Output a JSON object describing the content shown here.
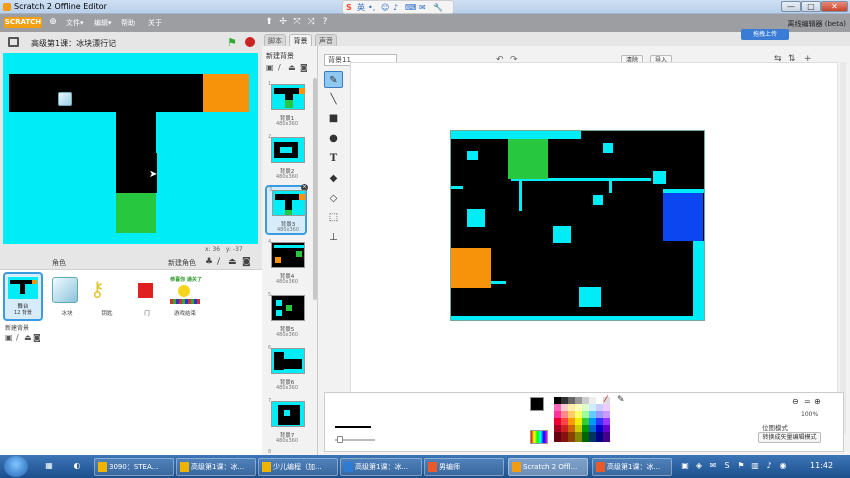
{
  "window": {
    "title": "Scratch 2 Offline Editor",
    "controls": {
      "minimize": "—",
      "maximize": "□",
      "close": "✕"
    }
  },
  "browser_overlay": {
    "items": [
      "英",
      "☺",
      "⚙",
      "✎",
      "🎤",
      "⌨",
      "✉",
      "🔧"
    ]
  },
  "menubar": {
    "logo": "SCRATCH",
    "globe_icon": "globe-icon",
    "menus": [
      "文件▾",
      "编辑▾",
      "帮助",
      "关于"
    ],
    "right_title": "离线编辑器 (beta)",
    "upload_label": "拖拽上传"
  },
  "stage": {
    "title": "高级第1课：冰块漂行记",
    "coords_x": "x: 36",
    "coords_y": "y: -37",
    "colors": {
      "bg": "#00ecf7",
      "wall": "#000000",
      "goal": "#27c83f",
      "start": "#f7930a"
    }
  },
  "sprites_panel": {
    "label": "角色",
    "new_sprite_label": "新建角色",
    "stage_thumb": {
      "name": "舞台",
      "count": "12 背景"
    },
    "new_backdrop_label": "新建背景",
    "sprites": [
      {
        "name": "冰块"
      },
      {
        "name": "钥匙"
      },
      {
        "name": "门"
      },
      {
        "name": "游戏结束",
        "text_top": "恭喜你 通关了"
      }
    ]
  },
  "tabs": [
    "脚本",
    "背景",
    "声音"
  ],
  "backdrops": {
    "header": "新建背景",
    "items": [
      {
        "num": "1",
        "name": "背景1",
        "size": "480x360"
      },
      {
        "num": "2",
        "name": "背景2",
        "size": "480x360"
      },
      {
        "num": "3",
        "name": "背景3",
        "size": "480x360"
      },
      {
        "num": "4",
        "name": "背景4",
        "size": "480x360"
      },
      {
        "num": "5",
        "name": "背景5",
        "size": "480x360"
      },
      {
        "num": "6",
        "name": "背景6",
        "size": "480x360"
      },
      {
        "num": "7",
        "name": "背景7",
        "size": "480x360"
      },
      {
        "num": "8",
        "name": "",
        "size": ""
      }
    ]
  },
  "editor": {
    "costume_name": "背景11",
    "clear_label": "清除",
    "import_label": "导入",
    "tools": [
      "brush-icon",
      "line-icon",
      "rect-icon",
      "ellipse-icon",
      "text-icon",
      "fill-icon",
      "eraser-icon",
      "select-icon",
      "stamp-icon"
    ],
    "zoom_level": "100%",
    "bitmap_mode": "位图模式",
    "convert_vector": "转换成矢量编辑模式"
  },
  "taskbar": {
    "tasks": [
      {
        "label": "3090：STEA...",
        "color": "#f0b400"
      },
      {
        "label": "高级第1课：冰...",
        "color": "#f0b400"
      },
      {
        "label": "少儿编程（加...",
        "color": "#f0b400"
      },
      {
        "label": "高级第1课：冰...",
        "color": "#2e7bd6"
      },
      {
        "label": "男编师",
        "color": "#e85a2a"
      },
      {
        "label": "Scratch 2 Offl...",
        "color": "#f39c12"
      },
      {
        "label": "高级第1课：冰...",
        "color": "#e85a2a"
      }
    ],
    "clock": "11:42"
  }
}
